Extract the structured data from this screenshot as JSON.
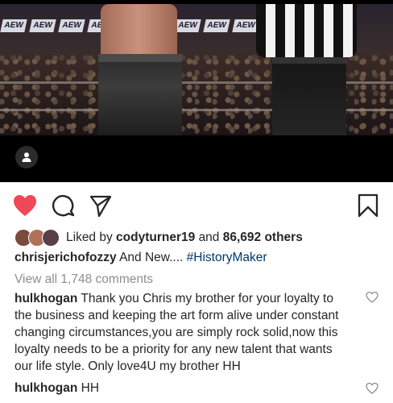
{
  "media": {
    "banner_text": "AEW",
    "banner_count": 12
  },
  "actions": {
    "like_icon": "heart-filled-icon",
    "comment_icon": "comment-icon",
    "share_icon": "share-icon",
    "save_icon": "bookmark-icon",
    "like_color": "#ed4956"
  },
  "likes": {
    "prefix": "Liked by",
    "user": "codyturner19",
    "conjunction": "and",
    "others": "86,692 others",
    "avatar_colors": [
      "#7a4b3a",
      "#b0705a",
      "#5a3f4a"
    ]
  },
  "caption": {
    "username": "chrisjerichofozzy",
    "text": "And New....",
    "hashtag": "#HistoryMaker"
  },
  "view_comments": "View all 1,748 comments",
  "comments": [
    {
      "username": "hulkhogan",
      "text": "Thank you Chris my brother for your loyalty to the business and keeping the art form alive under constant changing circumstances,you are simply rock solid,now this loyalty needs to be a priority for any new talent that wants our life style. Only love4U my brother HH"
    },
    {
      "username": "hulkhogan",
      "text": "HH"
    }
  ]
}
